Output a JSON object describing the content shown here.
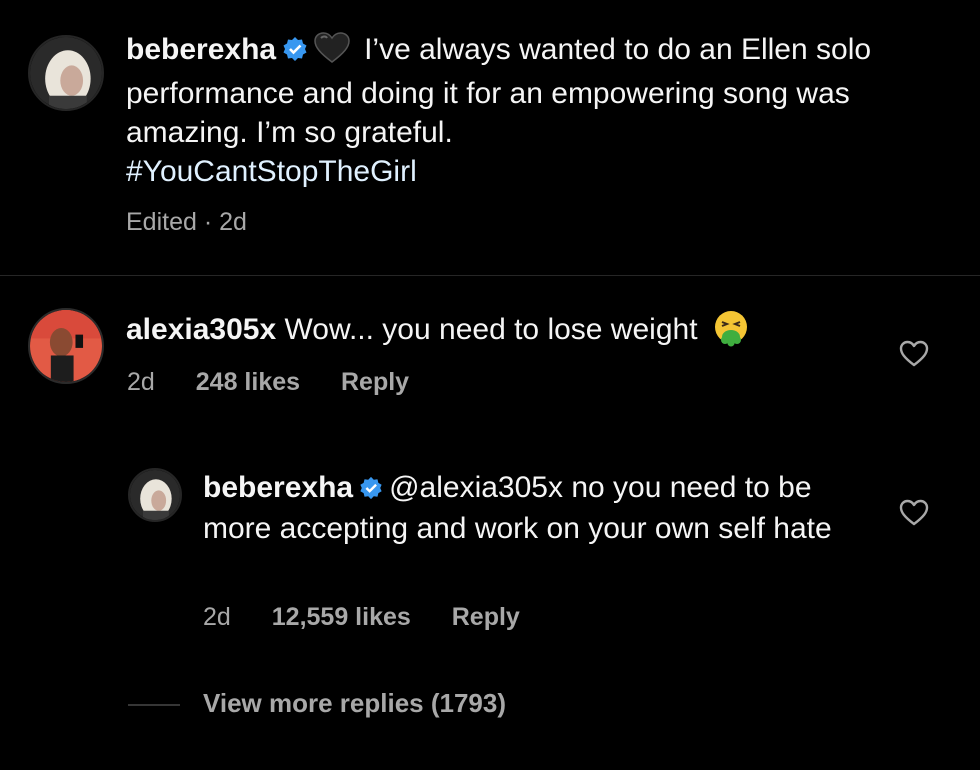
{
  "post": {
    "username": "beberexha",
    "emoji": "black-heart",
    "text": "I’ve always wanted to do an Ellen solo performance and doing it for an empowering song was amazing. I’m so grateful.",
    "hashtag": "#YouCantStopTheGirl",
    "edited_label": "Edited · 2d"
  },
  "comments": [
    {
      "username": "alexia305x",
      "text": "Wow... you need to lose weight",
      "emoji": "nauseated-face",
      "time": "2d",
      "likes": "248 likes",
      "reply_label": "Reply"
    }
  ],
  "reply": {
    "username": "beberexha",
    "mention": "@alexia305x",
    "text": "no you need to be more accepting and work on your own self hate",
    "time": "2d",
    "likes": "12,559 likes",
    "reply_label": "Reply"
  },
  "view_more": "View more replies (1793)",
  "colors": {
    "background": "#000000",
    "text": "#f5f5f5",
    "secondary": "#a8a8a8",
    "verified": "#3897f0"
  }
}
